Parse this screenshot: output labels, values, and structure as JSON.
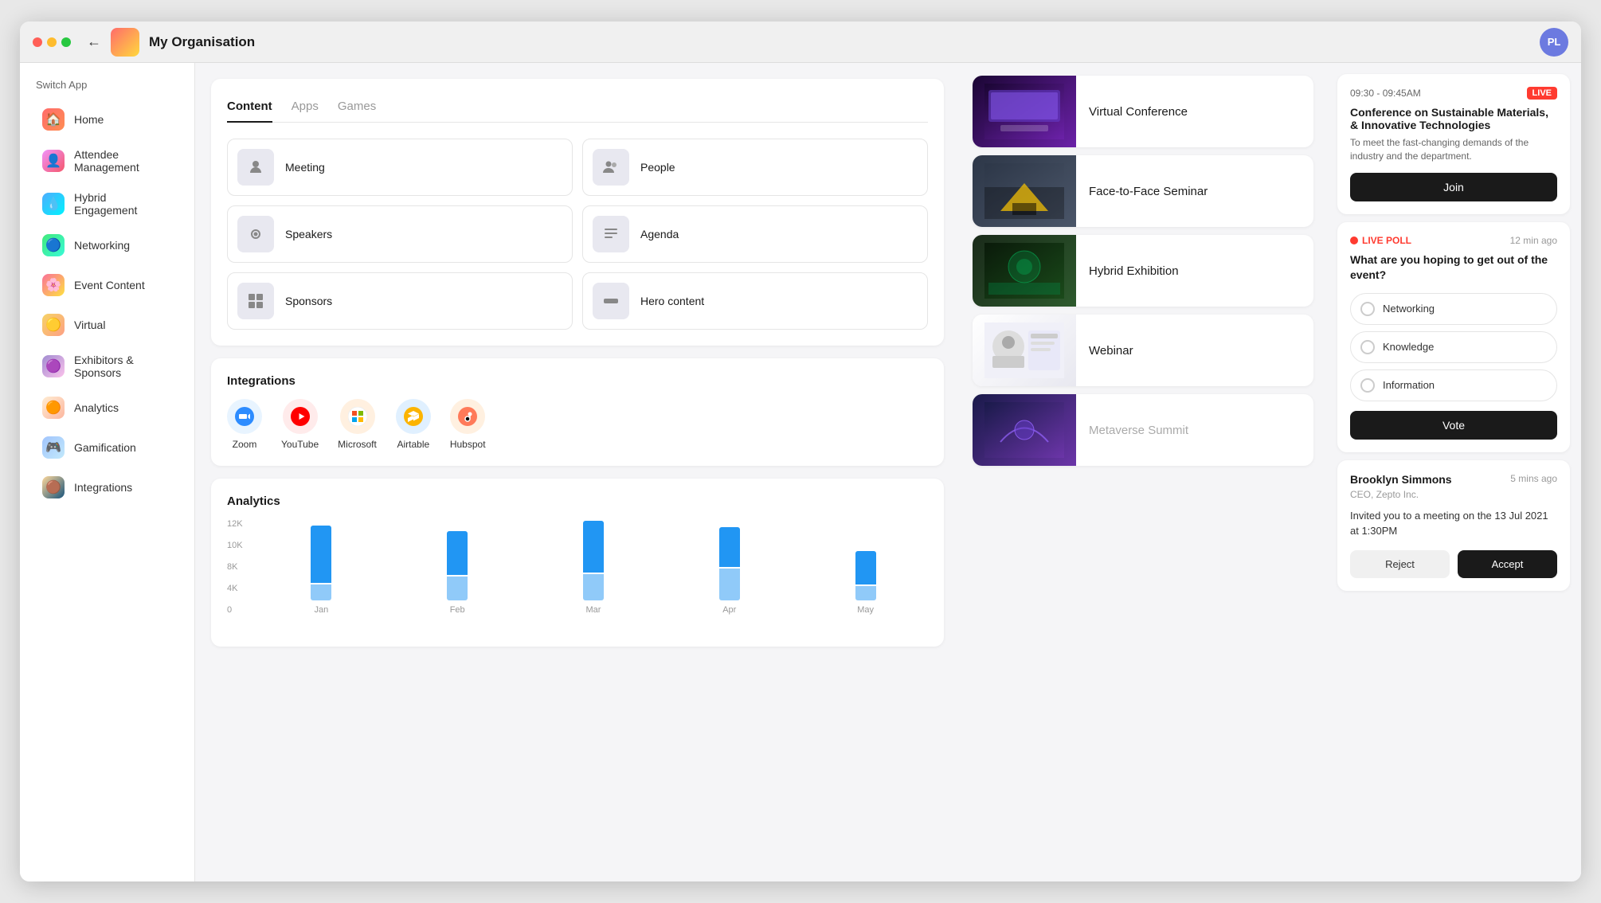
{
  "window": {
    "title": "My Organisation"
  },
  "titlebar": {
    "back_label": "←",
    "org_name": "My Organisation",
    "avatar_initials": "PL"
  },
  "sidebar": {
    "switch_app_label": "Switch App",
    "items": [
      {
        "id": "home",
        "label": "Home",
        "icon": "🏠"
      },
      {
        "id": "attendee",
        "label": "Attendee Management",
        "icon": "👤"
      },
      {
        "id": "hybrid",
        "label": "Hybrid Engagement",
        "icon": "💧"
      },
      {
        "id": "networking",
        "label": "Networking",
        "icon": "🔵"
      },
      {
        "id": "event",
        "label": "Event Content",
        "icon": "🌸"
      },
      {
        "id": "virtual",
        "label": "Virtual",
        "icon": "🟡"
      },
      {
        "id": "exhibitors",
        "label": "Exhibitors & Sponsors",
        "icon": "🟣"
      },
      {
        "id": "analytics",
        "label": "Analytics",
        "icon": "🟠"
      },
      {
        "id": "gamification",
        "label": "Gamification",
        "icon": "🎮"
      },
      {
        "id": "integrations",
        "label": "Integrations",
        "icon": "🟤"
      }
    ]
  },
  "content_panel": {
    "tabs": [
      {
        "id": "content",
        "label": "Content",
        "active": true
      },
      {
        "id": "apps",
        "label": "Apps",
        "active": false
      },
      {
        "id": "games",
        "label": "Games",
        "active": false
      }
    ],
    "content_items": [
      {
        "id": "meeting",
        "label": "Meeting",
        "icon": "👤"
      },
      {
        "id": "people",
        "label": "People",
        "icon": "👥"
      },
      {
        "id": "speakers",
        "label": "Speakers",
        "icon": "🎧"
      },
      {
        "id": "agenda",
        "label": "Agenda",
        "icon": "📋"
      },
      {
        "id": "sponsors",
        "label": "Sponsors",
        "icon": "⊞"
      },
      {
        "id": "hero",
        "label": "Hero content",
        "icon": "▬"
      }
    ]
  },
  "integrations": {
    "title": "Integrations",
    "items": [
      {
        "id": "zoom",
        "label": "Zoom",
        "icon": "📹",
        "color": "#e8f4ff"
      },
      {
        "id": "youtube",
        "label": "YouTube",
        "icon": "▶",
        "color": "#ffebeb"
      },
      {
        "id": "microsoft",
        "label": "Microsoft",
        "icon": "⊞",
        "color": "#fff0e0"
      },
      {
        "id": "airtable",
        "label": "Airtable",
        "icon": "◈",
        "color": "#e0f0ff"
      },
      {
        "id": "hubspot",
        "label": "Hubspot",
        "icon": "⚙",
        "color": "#fff0e0"
      }
    ]
  },
  "analytics": {
    "title": "Analytics",
    "y_labels": [
      "12K",
      "10K",
      "8K",
      "4K",
      "0"
    ],
    "bars": [
      {
        "label": "Jan",
        "dark": 72,
        "light": 20
      },
      {
        "label": "Feb",
        "dark": 55,
        "light": 30
      },
      {
        "label": "Mar",
        "dark": 68,
        "light": 35
      },
      {
        "label": "Apr",
        "dark": 50,
        "light": 40
      },
      {
        "label": "May",
        "dark": 42,
        "light": 18
      }
    ]
  },
  "events": [
    {
      "id": "vc",
      "name": "Virtual Conference",
      "thumb_type": "vc"
    },
    {
      "id": "face",
      "name": "Face-to-Face Seminar",
      "thumb_type": "face"
    },
    {
      "id": "hybrid",
      "name": "Hybrid Exhibition",
      "thumb_type": "hybrid"
    },
    {
      "id": "webinar",
      "name": "Webinar",
      "thumb_type": "webinar"
    },
    {
      "id": "metaverse",
      "name": "Metaverse Summit",
      "thumb_type": "metaverse",
      "dimmed": true
    }
  ],
  "live_session": {
    "time": "09:30 - 09:45AM",
    "live_label": "LIVE",
    "title": "Conference on Sustainable Materials, & Innovative Technologies",
    "description": "To meet the fast-changing demands of the industry and the department.",
    "join_label": "Join"
  },
  "live_poll": {
    "badge_label": "LIVE POLL",
    "time_ago": "12 min ago",
    "question": "What are you hoping to get out of the event?",
    "options": [
      {
        "id": "networking",
        "label": "Networking"
      },
      {
        "id": "knowledge",
        "label": "Knowledge"
      },
      {
        "id": "information",
        "label": "Information"
      }
    ],
    "vote_label": "Vote"
  },
  "invitation": {
    "inviter_name": "Brooklyn Simmons",
    "inviter_role": "CEO, Zepto Inc.",
    "time_ago": "5 mins ago",
    "message": "Invited you to a meeting on the 13 Jul 2021 at 1:30PM",
    "reject_label": "Reject",
    "accept_label": "Accept"
  }
}
